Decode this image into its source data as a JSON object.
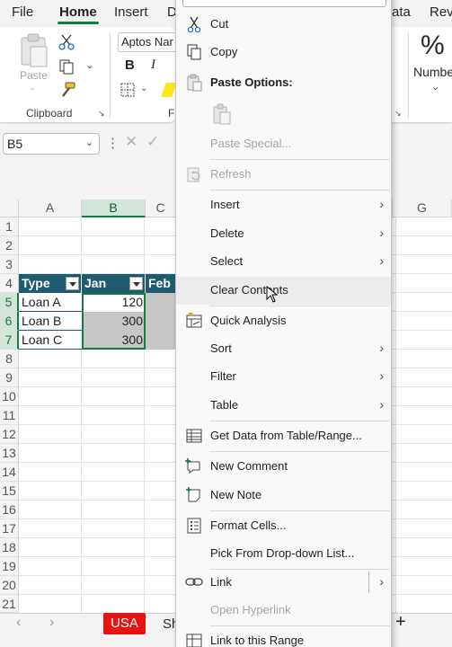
{
  "ribbon": {
    "tabs": [
      "File",
      "Home",
      "Insert",
      "D",
      "ata",
      "Rev"
    ],
    "active_tab": "Home",
    "clipboard_group": "Clipboard",
    "font_group_partial": "F",
    "paste_label": "Paste",
    "font_name": "Aptos Nar",
    "bold_label": "B",
    "italic_label": "I",
    "percent_symbol": "%",
    "number_group_partial": "Numbe"
  },
  "formula_bar": {
    "name_box": "B5",
    "dots": "⋮"
  },
  "grid": {
    "columns": [
      "A",
      "B",
      "C",
      "G"
    ],
    "selected_column": "B",
    "rows": [
      "1",
      "2",
      "3",
      "4",
      "5",
      "6",
      "7",
      "8",
      "9",
      "10",
      "11",
      "12",
      "13",
      "14",
      "15",
      "16",
      "17",
      "18",
      "19",
      "20",
      "21"
    ],
    "selected_rows": [
      "5",
      "6",
      "7"
    ],
    "table": {
      "headers": [
        "Type",
        "Jan",
        "Feb"
      ],
      "rows": [
        {
          "type": "Loan A",
          "jan": "120"
        },
        {
          "type": "Loan B",
          "jan": "300"
        },
        {
          "type": "Loan C",
          "jan": "300"
        }
      ]
    },
    "accent_color": "#107c41",
    "table_header_color": "#1f5b6e"
  },
  "sheet_tabs": {
    "active": "USA",
    "next_partial": "Sh",
    "active_color": "#e51515",
    "add": "+"
  },
  "context_menu": {
    "items": [
      {
        "label": "Cut",
        "icon": "scissors-icon",
        "disabled": false
      },
      {
        "label": "Copy",
        "icon": "copy-icon",
        "disabled": false
      },
      {
        "label": "Paste Options:",
        "icon": "clipboard-icon",
        "disabled": false
      },
      {
        "label": "",
        "icon": "paste-icon",
        "disabled": true
      },
      {
        "label": "Paste Special...",
        "icon": "",
        "disabled": true
      },
      {
        "label": "Refresh",
        "icon": "refresh-icon",
        "disabled": true
      },
      {
        "label": "Insert",
        "icon": "",
        "disabled": false,
        "submenu": true
      },
      {
        "label": "Delete",
        "icon": "",
        "disabled": false,
        "submenu": true
      },
      {
        "label": "Select",
        "icon": "",
        "disabled": false,
        "submenu": true
      },
      {
        "label": "Clear Contents",
        "icon": "",
        "disabled": false
      },
      {
        "label": "Quick Analysis",
        "icon": "quick-analysis-icon",
        "disabled": false
      },
      {
        "label": "Sort",
        "icon": "",
        "disabled": false,
        "submenu": true
      },
      {
        "label": "Filter",
        "icon": "",
        "disabled": false,
        "submenu": true
      },
      {
        "label": "Table",
        "icon": "",
        "disabled": false,
        "submenu": true
      },
      {
        "label": "Get Data from Table/Range...",
        "icon": "table-grid-icon",
        "disabled": false
      },
      {
        "label": "New Comment",
        "icon": "new-comment-icon",
        "disabled": false
      },
      {
        "label": "New Note",
        "icon": "new-note-icon",
        "disabled": false
      },
      {
        "label": "Format Cells...",
        "icon": "format-cells-icon",
        "disabled": false
      },
      {
        "label": "Pick From Drop-down List...",
        "icon": "",
        "disabled": false
      },
      {
        "label": "Link",
        "icon": "link-icon",
        "disabled": false,
        "submenu": true
      },
      {
        "label": "Open Hyperlink",
        "icon": "",
        "disabled": true
      },
      {
        "label": "Link to this Range",
        "icon": "link-range-icon",
        "disabled": false
      }
    ]
  }
}
